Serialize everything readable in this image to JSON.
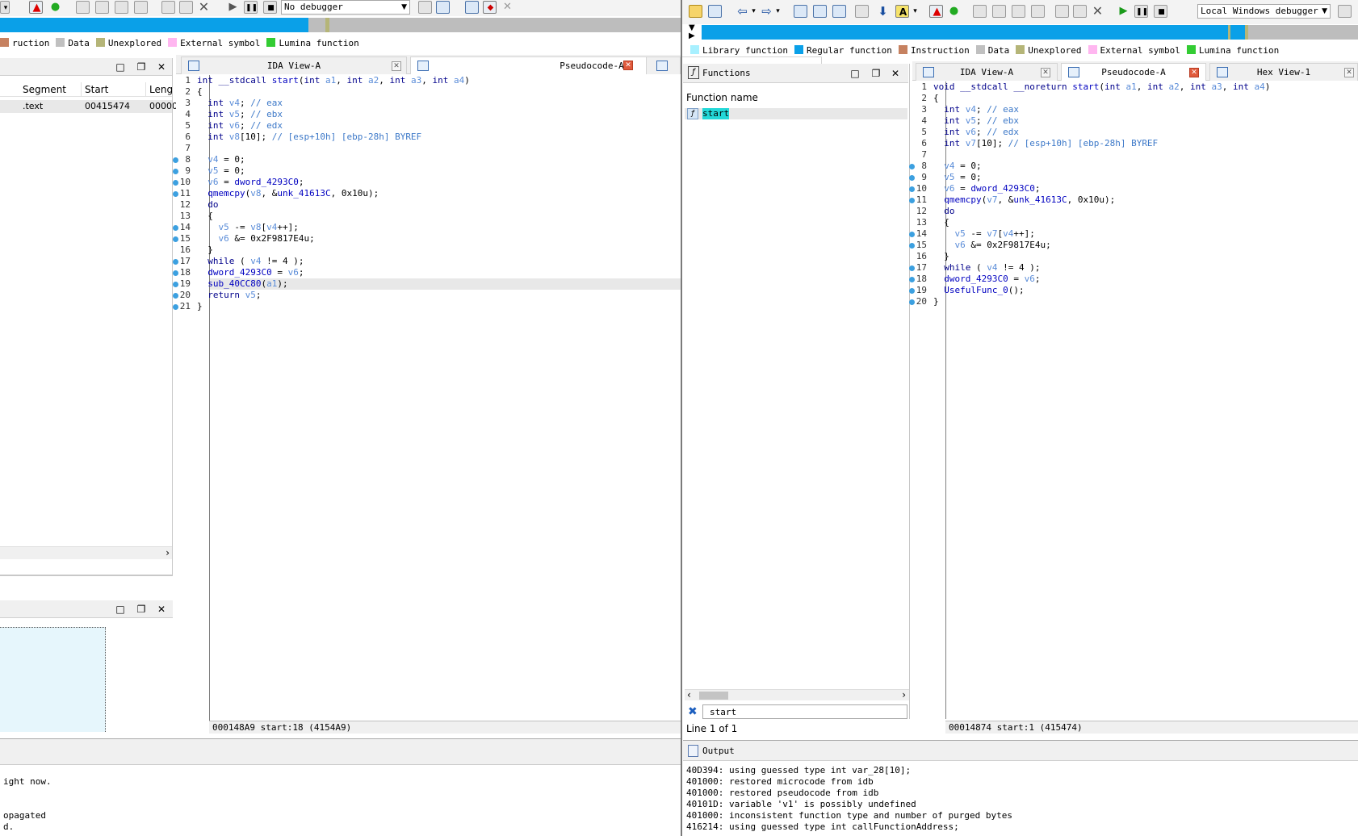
{
  "left": {
    "toolbar": {
      "debugger_combo": "No debugger"
    },
    "legend": [
      {
        "label": "ruction",
        "color": "#c68160"
      },
      {
        "label": "Data",
        "color": "#c0c0c0"
      },
      {
        "label": "Unexplored",
        "color": "#b5b578"
      },
      {
        "label": "External symbol",
        "color": "#ffb6f0"
      },
      {
        "label": "Lumina function",
        "color": "#33cc33"
      }
    ],
    "segments": {
      "headers": [
        "Segment",
        "Start",
        "Leng"
      ],
      "rows": [
        [
          ".text",
          "00415474",
          "00000"
        ]
      ]
    },
    "tabs": [
      {
        "label": "IDA View-A"
      },
      {
        "label": "Pseudocode-A"
      }
    ],
    "code": {
      "lines": [
        {
          "n": "1",
          "t": "int __stdcall start(int a1, int a2, int a3, int a4)",
          "bp": false
        },
        {
          "n": "2",
          "t": "{",
          "bp": false
        },
        {
          "n": "3",
          "t": "  int v4; // eax",
          "bp": false
        },
        {
          "n": "4",
          "t": "  int v5; // ebx",
          "bp": false
        },
        {
          "n": "5",
          "t": "  int v6; // edx",
          "bp": false
        },
        {
          "n": "6",
          "t": "  int v8[10]; // [esp+10h] [ebp-28h] BYREF",
          "bp": false
        },
        {
          "n": "7",
          "t": "",
          "bp": false
        },
        {
          "n": "8",
          "t": "  v4 = 0;",
          "bp": true
        },
        {
          "n": "9",
          "t": "  v5 = 0;",
          "bp": true
        },
        {
          "n": "10",
          "t": "  v6 = dword_4293C0;",
          "bp": true
        },
        {
          "n": "11",
          "t": "  qmemcpy(v8, &unk_41613C, 0x10u);",
          "bp": true
        },
        {
          "n": "12",
          "t": "  do",
          "bp": false
        },
        {
          "n": "13",
          "t": "  {",
          "bp": false
        },
        {
          "n": "14",
          "t": "    v5 -= v8[v4++];",
          "bp": true
        },
        {
          "n": "15",
          "t": "    v6 &= 0x2F9817E4u;",
          "bp": true
        },
        {
          "n": "16",
          "t": "  }",
          "bp": false
        },
        {
          "n": "17",
          "t": "  while ( v4 != 4 );",
          "bp": true
        },
        {
          "n": "18",
          "t": "  dword_4293C0 = v6;",
          "bp": true
        },
        {
          "n": "19",
          "t": "  sub_40CC80(a1);",
          "bp": true
        },
        {
          "n": "20",
          "t": "  return v5;",
          "bp": true
        },
        {
          "n": "21",
          "t": "}",
          "bp": true
        }
      ]
    },
    "status": "000148A9 start:18 (4154A9)",
    "output": [
      "ight now.",
      "opagated",
      "d."
    ]
  },
  "right": {
    "toolbar": {
      "debugger_combo": "Local Windows debugger"
    },
    "legend": [
      {
        "label": "Library function",
        "color": "#a8f0ff"
      },
      {
        "label": "Regular function",
        "color": "#0aa0e8"
      },
      {
        "label": "Instruction",
        "color": "#c68160"
      },
      {
        "label": "Data",
        "color": "#c0c0c0"
      },
      {
        "label": "Unexplored",
        "color": "#b5b578"
      },
      {
        "label": "External symbol",
        "color": "#ffb6f0"
      },
      {
        "label": "Lumina function",
        "color": "#33cc33"
      }
    ],
    "functions": {
      "title": "Functions",
      "header": "Function name",
      "items": [
        {
          "name": "start"
        }
      ],
      "search_value": "start",
      "line_info": "Line 1 of 1"
    },
    "tabs": [
      {
        "label": "IDA View-A"
      },
      {
        "label": "Pseudocode-A"
      },
      {
        "label": "Hex View-1"
      }
    ],
    "code": {
      "lines": [
        {
          "n": "1",
          "t": "void __stdcall __noreturn start(int a1, int a2, int a3, int a4)",
          "bp": false
        },
        {
          "n": "2",
          "t": "{",
          "bp": false
        },
        {
          "n": "3",
          "t": "  int v4; // eax",
          "bp": false
        },
        {
          "n": "4",
          "t": "  int v5; // ebx",
          "bp": false
        },
        {
          "n": "5",
          "t": "  int v6; // edx",
          "bp": false
        },
        {
          "n": "6",
          "t": "  int v7[10]; // [esp+10h] [ebp-28h] BYREF",
          "bp": false
        },
        {
          "n": "7",
          "t": "",
          "bp": false
        },
        {
          "n": "8",
          "t": "  v4 = 0;",
          "bp": true
        },
        {
          "n": "9",
          "t": "  v5 = 0;",
          "bp": true
        },
        {
          "n": "10",
          "t": "  v6 = dword_4293C0;",
          "bp": true
        },
        {
          "n": "11",
          "t": "  qmemcpy(v7, &unk_41613C, 0x10u);",
          "bp": true
        },
        {
          "n": "12",
          "t": "  do",
          "bp": false
        },
        {
          "n": "13",
          "t": "  {",
          "bp": false
        },
        {
          "n": "14",
          "t": "    v5 -= v7[v4++];",
          "bp": true
        },
        {
          "n": "15",
          "t": "    v6 &= 0x2F9817E4u;",
          "bp": true
        },
        {
          "n": "16",
          "t": "  }",
          "bp": false
        },
        {
          "n": "17",
          "t": "  while ( v4 != 4 );",
          "bp": true
        },
        {
          "n": "18",
          "t": "  dword_4293C0 = v6;",
          "bp": true
        },
        {
          "n": "19",
          "t": "  UsefulFunc_0();",
          "bp": true
        },
        {
          "n": "20",
          "t": "}",
          "bp": true
        }
      ]
    },
    "status": "00014874 start:1 (415474)",
    "output": {
      "title": "Output",
      "lines": [
        "40D394: using guessed type int var_28[10];",
        "401000: restored microcode from idb",
        "401000: restored pseudocode from idb",
        "40101D: variable 'v1' is possibly undefined",
        "401000: inconsistent function type and number of purged bytes",
        "416214: using guessed type int callFunctionAddress;"
      ]
    }
  }
}
